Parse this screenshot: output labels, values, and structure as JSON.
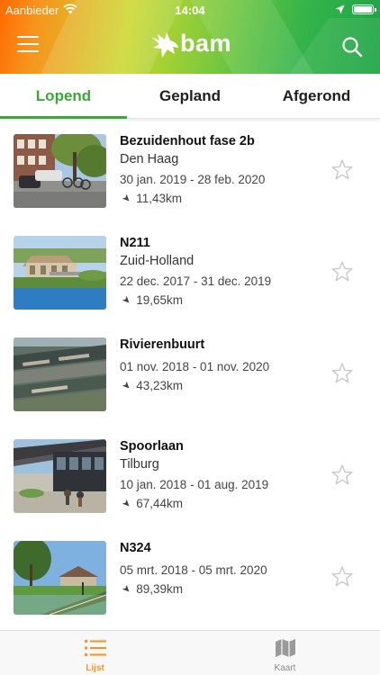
{
  "status_bar": {
    "carrier": "Aanbieder",
    "time": "14:04",
    "battery_level": 1.0
  },
  "header": {
    "logo_text": "bam",
    "menu_icon": "hamburger-icon",
    "search_icon": "search-icon"
  },
  "tabs": [
    {
      "label": "Lopend",
      "active": true
    },
    {
      "label": "Gepland",
      "active": false
    },
    {
      "label": "Afgerond",
      "active": false
    }
  ],
  "projects": [
    {
      "title": "Bezuidenhout fase 2b",
      "location": "Den Haag",
      "dates": "30 jan. 2019 - 28 feb. 2020",
      "distance": "11,43km",
      "favorite": false
    },
    {
      "title": "N211",
      "location": "Zuid-Holland",
      "dates": "22 dec. 2017 - 31 dec. 2019",
      "distance": "19,65km",
      "favorite": false
    },
    {
      "title": "Rivierenbuurt",
      "location": "",
      "dates": "01 nov. 2018 - 01 nov. 2020",
      "distance": "43,23km",
      "favorite": false
    },
    {
      "title": "Spoorlaan",
      "location": "Tilburg",
      "dates": "10 jan. 2018 - 01 aug. 2019",
      "distance": "67,44km",
      "favorite": false
    },
    {
      "title": "N324",
      "location": "",
      "dates": "05 mrt. 2018 - 05 mrt. 2020",
      "distance": "89,39km",
      "favorite": false
    }
  ],
  "bottom_bar": {
    "tabs": [
      {
        "label": "Lijst",
        "icon": "list-icon",
        "active": true
      },
      {
        "label": "Kaart",
        "icon": "map-icon",
        "active": false
      }
    ]
  },
  "colors": {
    "accent_green": "#39a935",
    "accent_orange": "#f7941d",
    "star_outline": "#c8c8c8"
  }
}
